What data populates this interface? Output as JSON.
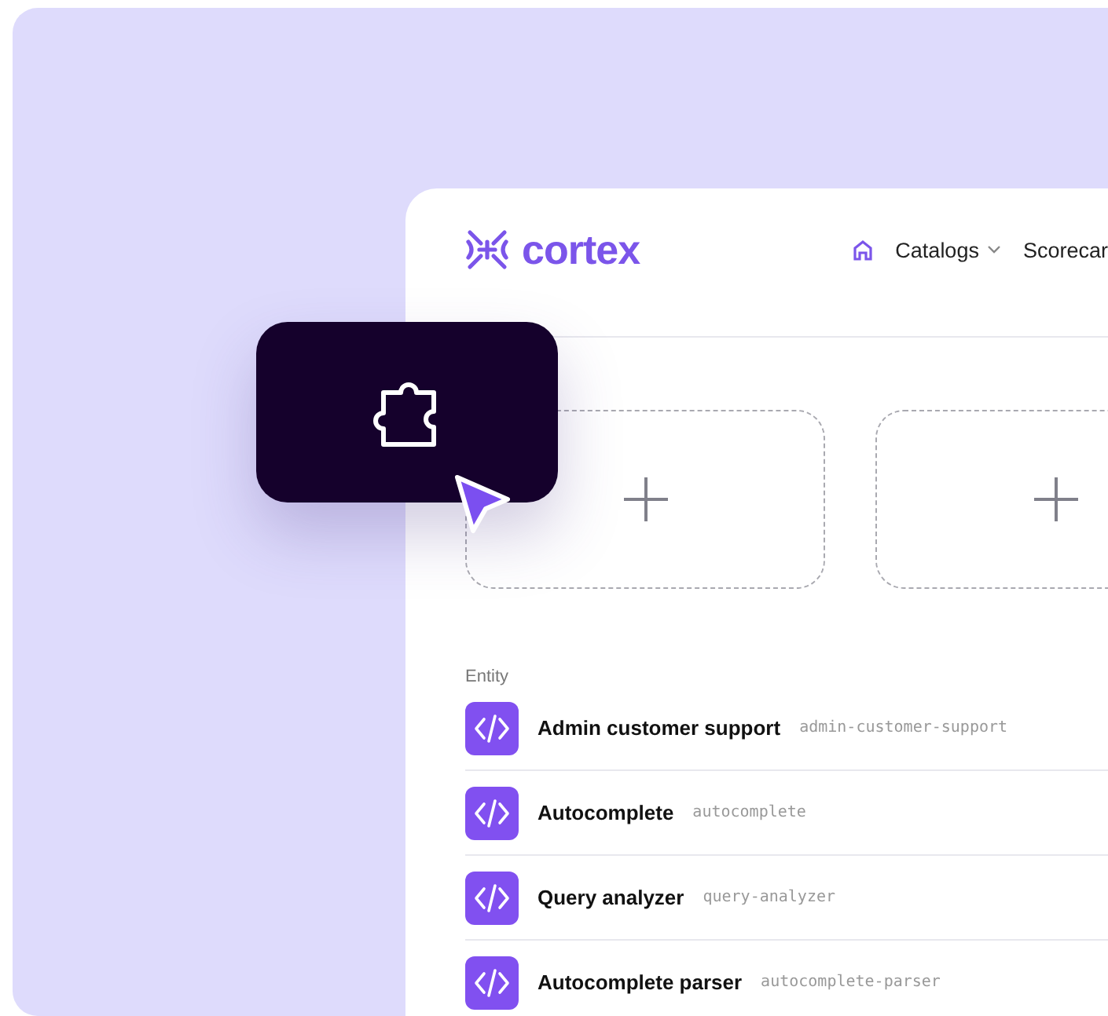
{
  "logo": {
    "text": "cortex"
  },
  "nav": [
    {
      "label": "Catalogs",
      "kind": "dropdown"
    },
    {
      "label": "Scorecar",
      "kind": "link"
    }
  ],
  "placeholders": [
    {
      "kind": "add"
    },
    {
      "kind": "add"
    }
  ],
  "entity_list": {
    "heading": "Entity",
    "rows": [
      {
        "name": "Admin customer support",
        "tag": "admin-customer-support"
      },
      {
        "name": "Autocomplete",
        "tag": "autocomplete"
      },
      {
        "name": "Query analyzer",
        "tag": "query-analyzer"
      },
      {
        "name": "Autocomplete parser",
        "tag": "autocomplete-parser"
      }
    ]
  }
}
